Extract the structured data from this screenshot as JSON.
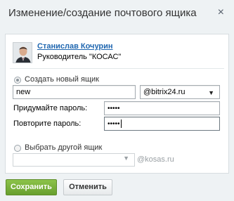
{
  "dialog": {
    "title": "Изменение/создание почтового ящика",
    "close_glyph": "×"
  },
  "user": {
    "name": "Станислав Кочурин",
    "position": "Руководитель \"КОСАС\""
  },
  "create_option": {
    "label": "Создать новый ящик",
    "checked": true,
    "mailbox_name": "new",
    "domain_selected": "@bitrix24.ru",
    "password_label": "Придумайте пароль:",
    "password_value": "•••••",
    "confirm_label": "Повторите пароль:",
    "confirm_value": "•••••"
  },
  "other_option": {
    "label": "Выбрать другой ящик",
    "checked": false,
    "select_value": "",
    "domain_suffix": "@kosas.ru"
  },
  "buttons": {
    "save": "Сохранить",
    "cancel": "Отменить"
  },
  "colors": {
    "accent_green": "#7ab43c",
    "link_blue": "#2067b0",
    "dialog_bg": "#eef2f4"
  },
  "icons": {
    "close": "close-icon",
    "avatar": "avatar",
    "caret": "chevron-down-icon"
  }
}
